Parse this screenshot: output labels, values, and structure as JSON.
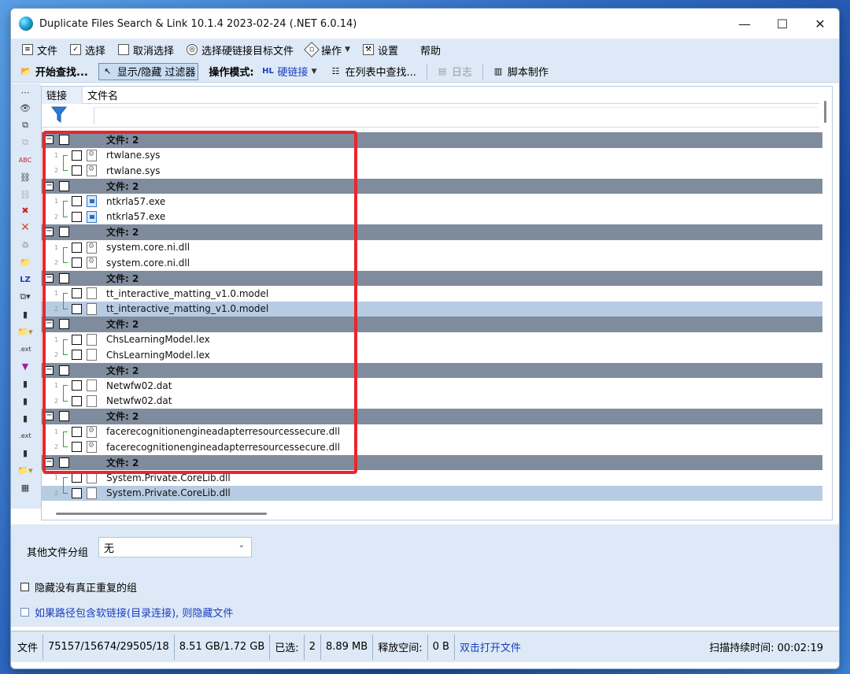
{
  "window": {
    "title": "Duplicate Files Search & Link 10.1.4 2023-02-24 (.NET 6.0.14)"
  },
  "titlebar_controls": {
    "minimize": "—",
    "maximize": "☐",
    "close": "✕"
  },
  "menu": [
    {
      "label": "文件",
      "icon": "file-icon"
    },
    {
      "label": "选择",
      "icon": "select-icon"
    },
    {
      "label": "取消选择",
      "icon": "deselect-icon"
    },
    {
      "label": "选择硬链接目标文件",
      "icon": "target-icon"
    },
    {
      "label": "操作",
      "icon": "operation-icon",
      "dropdown": true
    },
    {
      "label": "设置",
      "icon": "settings-icon"
    },
    {
      "label": "帮助"
    }
  ],
  "toolbar": {
    "start_search": "开始查找...",
    "toggle_filter": "显示/隐藏 过滤器",
    "mode_label": "操作模式:",
    "mode_hl_icon": "HL",
    "mode_value": "硬链接",
    "find_in_list": "在列表中查找...",
    "log": "日志",
    "script": "脚本制作"
  },
  "grid": {
    "columns": [
      "链接",
      "文件名"
    ],
    "group_label": "文件: 2",
    "groups": [
      {
        "files": [
          {
            "index": "1",
            "name": "rtwlane.sys",
            "type": "sys"
          },
          {
            "index": "2",
            "name": "rtwlane.sys",
            "type": "sys"
          }
        ]
      },
      {
        "files": [
          {
            "index": "1",
            "name": "ntkrla57.exe",
            "type": "exe"
          },
          {
            "index": "2",
            "name": "ntkrla57.exe",
            "type": "exe"
          }
        ]
      },
      {
        "files": [
          {
            "index": "1",
            "name": "system.core.ni.dll",
            "type": "sys"
          },
          {
            "index": "2",
            "name": "system.core.ni.dll",
            "type": "sys"
          }
        ]
      },
      {
        "files": [
          {
            "index": "1",
            "name": "tt_interactive_matting_v1.0.model",
            "type": "plain"
          },
          {
            "index": "2",
            "name": "tt_interactive_matting_v1.0.model",
            "type": "plain",
            "selected": true
          }
        ]
      },
      {
        "files": [
          {
            "index": "1",
            "name": "ChsLearningModel.lex",
            "type": "plain"
          },
          {
            "index": "2",
            "name": "ChsLearningModel.lex",
            "type": "plain"
          }
        ]
      },
      {
        "files": [
          {
            "index": "1",
            "name": "Netwfw02.dat",
            "type": "plain"
          },
          {
            "index": "2",
            "name": "Netwfw02.dat",
            "type": "plain"
          }
        ]
      },
      {
        "files": [
          {
            "index": "1",
            "name": "facerecognitionengineadapterresourcessecure.dll",
            "type": "sys"
          },
          {
            "index": "2",
            "name": "facerecognitionengineadapterresourcessecure.dll",
            "type": "sys"
          }
        ]
      },
      {
        "files": [
          {
            "index": "1",
            "name": "System.Private.CoreLib.dll",
            "type": "plain"
          },
          {
            "index": "2",
            "name": "System.Private.CoreLib.dll",
            "type": "plain",
            "selected": true
          }
        ]
      }
    ]
  },
  "bottom": {
    "other_group_label": "其他文件分组",
    "other_group_value": "无",
    "hide_not_real_dup": "隐藏没有真正重复的组",
    "hide_softlink": "如果路径包含软链接(目录连接), 则隐藏文件"
  },
  "status": {
    "files_label": "文件",
    "counts": "75157/15674/29505/18",
    "sizes": "8.51 GB/1.72 GB",
    "selected_label": "已选:",
    "selected_count": "2",
    "selected_size": "8.89 MB",
    "free_label": "释放空间:",
    "free_value": "0 B",
    "open_file": "双击打开文件",
    "duration": "扫描持续时间: 00:02:19"
  },
  "colors": {
    "group_row": "#7f8c9d",
    "selected_row": "#b7cce3",
    "highlight": "#e8262b",
    "link_text": "#1a3dbf"
  }
}
